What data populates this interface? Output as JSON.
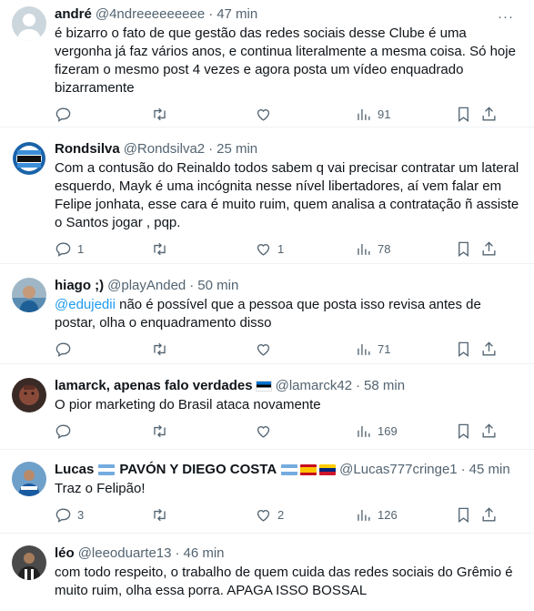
{
  "tweets": [
    {
      "name": "andré",
      "handle": "@4ndreeeeeeeee",
      "time": "47 min",
      "text": "é bizarro o fato de que gestão das redes sociais desse Clube é uma vergonha já faz vários anos, e continua literalmente a mesma coisa. Só hoje fizeram o mesmo post 4 vezes e agora posta um vídeo enquadrado bizarramente",
      "replies": "",
      "retweets": "",
      "likes": "",
      "views": "91"
    },
    {
      "name": "Rondsilva",
      "handle": "@Rondsilva2",
      "time": "25 min",
      "text": "Com a contusão do Reinaldo todos sabem q vai precisar contratar um lateral esquerdo, Mayk é uma incógnita nesse nível libertadores, aí vem falar em Felipe jonhata, esse cara é muito ruim, quem analisa a contratação ñ assiste o Santos jogar , pqp.",
      "replies": "1",
      "retweets": "",
      "likes": "1",
      "views": "78"
    },
    {
      "name": "hiago ;)",
      "handle": "@playAnded",
      "time": "50 min",
      "mention": "@edujedii",
      "text": " não é possível que a pessoa que posta isso revisa antes de postar, olha o enquadramento disso",
      "replies": "",
      "retweets": "",
      "likes": "",
      "views": "71"
    },
    {
      "name": "lamarck, apenas falo verdades",
      "handle": "@lamarck42",
      "time": "58 min",
      "text": "O pior marketing do Brasil ataca novamente",
      "replies": "",
      "retweets": "",
      "likes": "",
      "views": "169"
    },
    {
      "name": "Lucas",
      "name_suffix": "PAVÓN Y DIEGO COSTA",
      "handle": "@Lucas777cringe1",
      "time": "45 min",
      "text": "Traz o Felipão!",
      "replies": "3",
      "retweets": "",
      "likes": "2",
      "views": "126"
    },
    {
      "name": "léo",
      "handle": "@leeoduarte13",
      "time": "46 min",
      "text": "com todo respeito, o trabalho de quem cuida das redes sociais do Grêmio é muito ruim, olha essa porra. APAGA ISSO BOSSAL"
    }
  ],
  "ui": {
    "dot": "·",
    "more": "···",
    "icons": [
      "reply-icon",
      "retweet-icon",
      "like-icon",
      "views-icon",
      "bookmark-icon",
      "share-icon",
      "more-icon"
    ]
  },
  "colors": {
    "text": "#0f1419",
    "secondary": "#536471",
    "link": "#1d9bf0",
    "divider": "#eff3f4"
  }
}
